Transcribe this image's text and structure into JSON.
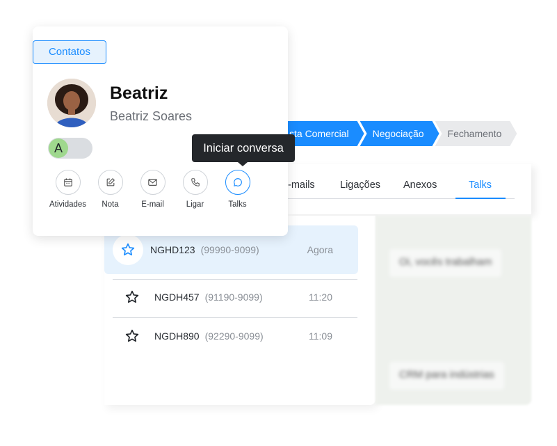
{
  "pipeline": {
    "stages": [
      {
        "label": "sta Comercial",
        "active": true
      },
      {
        "label": "Negociação",
        "active": true
      },
      {
        "label": "Fechamento",
        "active": false
      }
    ]
  },
  "tabs": [
    {
      "label": "-mails",
      "active": false
    },
    {
      "label": "Ligações",
      "active": false
    },
    {
      "label": "Anexos",
      "active": false
    },
    {
      "label": "Talks",
      "active": true
    }
  ],
  "conversations": [
    {
      "code": "NGHD123",
      "phone": "(99990-9099)",
      "time": "Agora",
      "selected": true
    },
    {
      "code": "NGDH457",
      "phone": "(91190-9099)",
      "time": "11:20",
      "selected": false
    },
    {
      "code": "NGDH890",
      "phone": "(92290-9099)",
      "time": "11:09",
      "selected": false
    }
  ],
  "chat": {
    "messages": [
      "Oi, vocês trabalham",
      "CRM para indústrias"
    ]
  },
  "contact": {
    "section_label": "Contatos",
    "name": "Beatriz",
    "full_name": "Beatriz Soares",
    "toggle_initial": "A",
    "actions": [
      {
        "label": "Atividades",
        "icon": "calendar-icon"
      },
      {
        "label": "Nota",
        "icon": "edit-note-icon"
      },
      {
        "label": "E-mail",
        "icon": "mail-icon"
      },
      {
        "label": "Ligar",
        "icon": "phone-icon"
      },
      {
        "label": "Talks",
        "icon": "chat-bubble-icon"
      }
    ],
    "tooltip": "Iniciar conversa"
  },
  "colors": {
    "accent": "#1a8cff",
    "selected_bg": "#e6f2fd",
    "tooltip_bg": "#24272b",
    "toggle_knob": "#9fd88e"
  }
}
